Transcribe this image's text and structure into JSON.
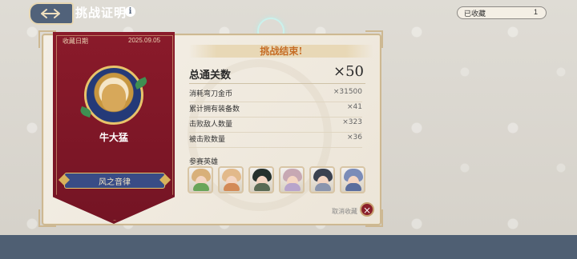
{
  "header": {
    "title": "挑战证明",
    "info_icon": "i",
    "collected_label": "已收藏",
    "collected_count": "1"
  },
  "certificate": {
    "date_label": "收藏日期",
    "date_value": "2025.09.05",
    "hero_name": "牛大猛",
    "ribbon_label": "风之音律"
  },
  "result": {
    "header": "挑战结束!",
    "stats_title": "总通关数",
    "stats_total": "×50",
    "rows": [
      {
        "label": "消耗弯刀金币",
        "value": "×31500"
      },
      {
        "label": "累计拥有装备数",
        "value": "×41"
      },
      {
        "label": "击败敌人数量",
        "value": "×323"
      },
      {
        "label": "被击败数量",
        "value": "×36"
      }
    ],
    "heroes_label": "参赛英雄",
    "cancel_label": "取消收藏",
    "cancel_icon": "×"
  },
  "colors": {
    "banner": "#7a1626",
    "accent": "#c66d25",
    "back_button": "#51627a"
  }
}
